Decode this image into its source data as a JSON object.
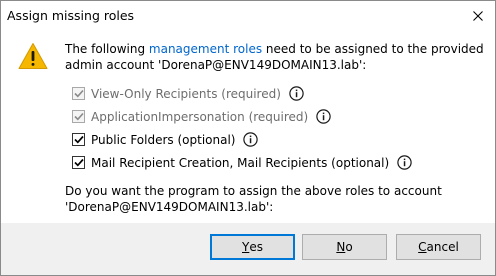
{
  "window": {
    "title": "Assign missing roles"
  },
  "icons": {
    "warning": "warning-icon",
    "close": "close-icon",
    "info": "info-icon",
    "checkbox_checked": "checkmark-icon"
  },
  "message": {
    "prefix": "The following ",
    "link_text": "management roles",
    "suffix": " need to be assigned to the provided admin account 'DorenaP@ENV149DOMAIN13.lab':"
  },
  "roles": [
    {
      "label": "View-Only Recipients (required)",
      "checked": true,
      "disabled": true
    },
    {
      "label": "ApplicationImpersonation (required)",
      "checked": true,
      "disabled": true
    },
    {
      "label": "Public Folders (optional)",
      "checked": true,
      "disabled": false
    },
    {
      "label": "Mail Recipient Creation, Mail Recipients (optional)",
      "checked": true,
      "disabled": false
    }
  ],
  "question": "Do you want the program to assign the above roles to account 'DorenaP@ENV149DOMAIN13.lab':",
  "buttons": {
    "yes_label": "Yes",
    "yes_mnemonic": "Y",
    "yes_rest": "es",
    "no_label": "No",
    "no_mnemonic": "N",
    "no_rest": "o",
    "cancel_label": "Cancel",
    "cancel_mnemonic": "C",
    "cancel_rest": "ancel"
  },
  "colors": {
    "link": "#0066cc",
    "warning_fill": "#f5b700",
    "default_button_border": "#0078d7",
    "footer_bg": "#f0f0f0"
  }
}
